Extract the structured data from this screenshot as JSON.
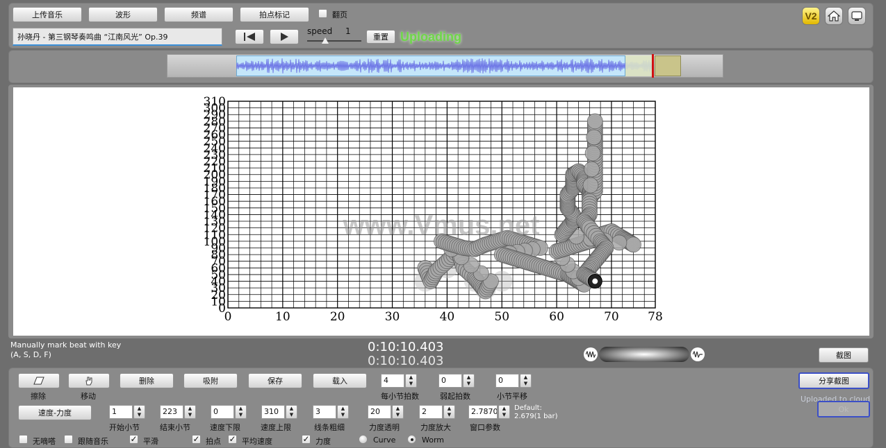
{
  "toolbar": {
    "upload_music": "上传音乐",
    "waveform": "波形",
    "spectrum": "频谱",
    "beat_mark": "拍点标记",
    "page_turn_label": "翻页",
    "page_turn_checked": false,
    "song_title": "孙晓丹 - 第三钢琴奏鸣曲 “江南风光” Op.39",
    "speed_label": "speed",
    "speed_value": "1",
    "reset": "重置",
    "status": "Uploading",
    "icons": [
      "v2-icon",
      "home-icon",
      "screen-icon"
    ],
    "v2_label": "V2"
  },
  "status_colors": {
    "uploading": "#6fd64a",
    "accent_border": "#3b4fc7"
  },
  "chart_data": {
    "type": "scatter",
    "watermark": "www.Vmus.net",
    "xlim": [
      0,
      78
    ],
    "ylim": [
      0,
      310
    ],
    "x_ticks": [
      0,
      10,
      20,
      30,
      40,
      50,
      60,
      70,
      78
    ],
    "y_ticks": [
      0,
      10,
      20,
      30,
      40,
      50,
      60,
      70,
      80,
      90,
      100,
      110,
      120,
      130,
      140,
      150,
      160,
      170,
      180,
      190,
      200,
      210,
      220,
      230,
      240,
      250,
      260,
      270,
      280,
      290,
      300,
      310
    ],
    "grid": true,
    "style": "worm",
    "series": [
      {
        "points": [
          [
            36,
            60
          ],
          [
            37,
            40
          ],
          [
            38,
            55
          ],
          [
            40,
            70
          ],
          [
            42,
            85
          ],
          [
            43,
            60
          ],
          [
            45,
            45
          ],
          [
            46,
            35
          ],
          [
            47,
            25
          ],
          [
            48,
            40
          ],
          [
            39,
            100
          ],
          [
            41,
            95
          ],
          [
            43,
            90
          ],
          [
            45,
            88
          ],
          [
            47,
            95
          ],
          [
            49,
            100
          ],
          [
            51,
            105
          ],
          [
            53,
            100
          ],
          [
            55,
            95
          ],
          [
            57,
            90
          ],
          [
            50,
            80
          ],
          [
            52,
            75
          ],
          [
            54,
            70
          ],
          [
            56,
            65
          ],
          [
            58,
            60
          ],
          [
            60,
            55
          ],
          [
            62,
            50
          ],
          [
            63,
            45
          ],
          [
            64,
            40
          ],
          [
            65,
            35
          ],
          [
            60,
            85
          ],
          [
            62,
            90
          ],
          [
            64,
            95
          ],
          [
            66,
            100
          ],
          [
            68,
            110
          ],
          [
            70,
            115
          ],
          [
            72,
            105
          ],
          [
            73,
            100
          ],
          [
            74,
            95
          ],
          [
            61,
            110
          ],
          [
            62,
            120
          ],
          [
            63,
            130
          ],
          [
            63,
            140
          ],
          [
            62,
            150
          ],
          [
            62,
            160
          ],
          [
            62,
            170
          ],
          [
            63,
            180
          ],
          [
            63,
            190
          ],
          [
            63,
            200
          ],
          [
            64,
            205
          ],
          [
            65,
            195
          ],
          [
            65,
            185
          ],
          [
            66,
            175
          ],
          [
            66,
            165
          ],
          [
            67,
            175
          ],
          [
            67,
            195
          ],
          [
            67,
            215
          ],
          [
            67,
            235
          ],
          [
            67,
            250
          ],
          [
            67,
            265
          ],
          [
            67,
            280
          ],
          [
            66,
            160
          ],
          [
            66,
            140
          ],
          [
            65,
            130
          ],
          [
            66,
            120
          ],
          [
            68,
            100
          ],
          [
            69,
            90
          ],
          [
            68,
            80
          ],
          [
            67,
            70
          ],
          [
            66,
            60
          ],
          [
            65,
            50
          ],
          [
            66,
            45
          ],
          [
            67,
            40
          ]
        ]
      }
    ]
  },
  "playback": {
    "hint_line1": "Manually mark beat with key",
    "hint_line2": "(A, S, D, F)",
    "time_current": "0:10:10.403",
    "time_total": "0:10:10.403",
    "screenshot": "截图"
  },
  "controls": {
    "erase": "擦除",
    "move": "移动",
    "delete": "删除",
    "snap": "吸附",
    "save": "保存",
    "load": "载入",
    "speed_force": "速度-力度",
    "beats_per_bar_label": "每小节拍数",
    "beats_per_bar": "4",
    "pickup_label": "弱起拍数",
    "pickup": "0",
    "bar_shift_label": "小节平移",
    "bar_shift": "0",
    "share_screenshot": "分享截图",
    "uploaded": "Uploaded to cloud",
    "ok": "Ok",
    "start_bar_label": "开始小节",
    "start_bar": "1",
    "end_bar_label": "结束小节",
    "end_bar": "223",
    "speed_min_label": "速度下限",
    "speed_min": "0",
    "speed_max_label": "速度上限",
    "speed_max": "310",
    "line_width_label": "线条粗细",
    "line_width": "3",
    "force_alpha_label": "力度透明",
    "force_alpha": "20",
    "force_scale_label": "力度放大",
    "force_scale": "2",
    "window_label": "窗口参数",
    "window": "2.7870",
    "default_line1": "Default:",
    "default_line2": "2.679(1 bar)",
    "metronome_off": "无嘀嗒",
    "follow_music": "跟随音乐",
    "smooth": "平滑",
    "beat_points": "拍点",
    "avg_speed": "平均速度",
    "force": "力度",
    "curve": "Curve",
    "worm": "Worm",
    "checks": {
      "metronome_off": false,
      "follow_music": false,
      "smooth": true,
      "beat_points": true,
      "avg_speed": true,
      "force": true
    },
    "mode": "Worm"
  }
}
